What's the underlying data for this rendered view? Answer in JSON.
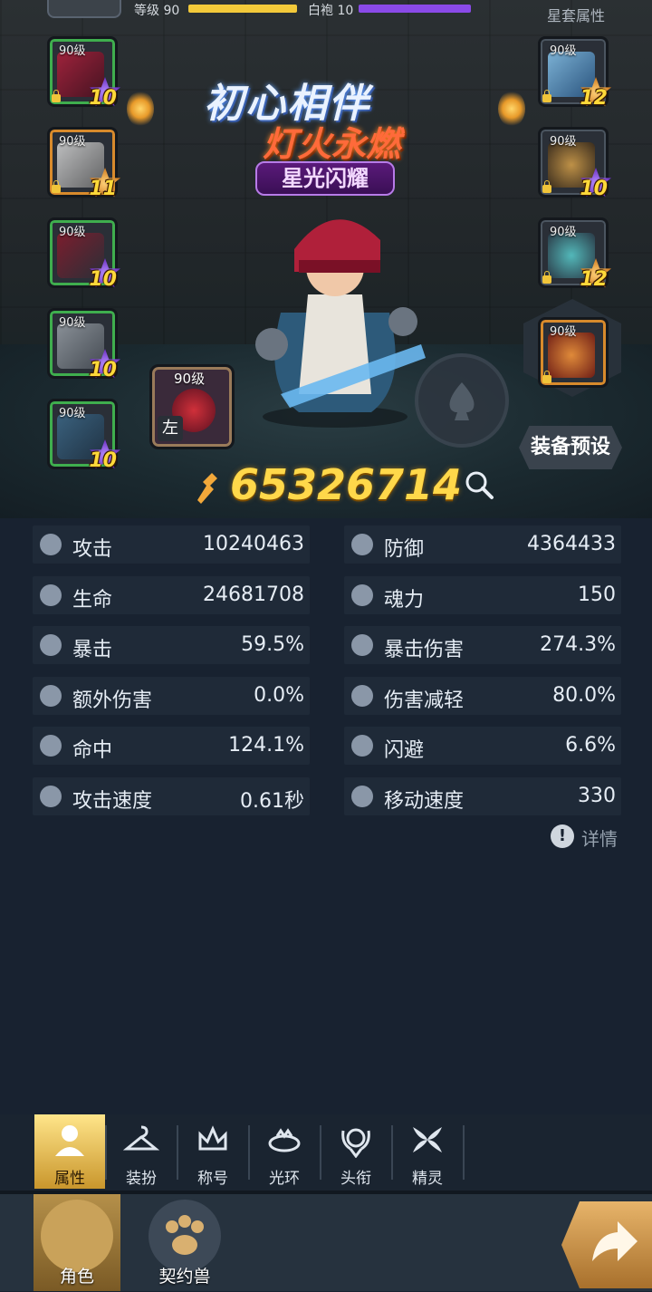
{
  "header": {
    "level_label": "等级 90",
    "level_fill": 1.0,
    "rank_label": "白袍 10",
    "rank_fill": 1.0,
    "set_attr_label": "星套属性"
  },
  "event_titles": {
    "line1": "初心相伴",
    "line2": "灯火永燃",
    "line3": "星光闪耀"
  },
  "equipment_left": [
    {
      "level": "90级",
      "stars": "10"
    },
    {
      "level": "90级",
      "stars": "11"
    },
    {
      "level": "90级",
      "stars": "10"
    },
    {
      "level": "90级",
      "stars": "10"
    },
    {
      "level": "90级",
      "stars": "10"
    }
  ],
  "equipment_right": [
    {
      "level": "90级",
      "stars": "12"
    },
    {
      "level": "90级",
      "stars": "10"
    },
    {
      "level": "90级",
      "stars": "12"
    },
    {
      "level": "90级",
      "stars": ""
    }
  ],
  "weapon_slot": {
    "level": "90级",
    "tag": "左"
  },
  "preset_button": "装备预设",
  "combat_power": "65326714",
  "stats": [
    {
      "name": "攻击",
      "value": "10240463",
      "icon": "sword-icon"
    },
    {
      "name": "防御",
      "value": "4364433",
      "icon": "shield-icon"
    },
    {
      "name": "生命",
      "value": "24681708",
      "icon": "heart-icon"
    },
    {
      "name": "魂力",
      "value": "150",
      "icon": "soul-icon"
    },
    {
      "name": "暴击",
      "value": "59.5%",
      "icon": "crit-icon"
    },
    {
      "name": "暴击伤害",
      "value": "274.3%",
      "icon": "crit-damage-icon"
    },
    {
      "name": "额外伤害",
      "value": "0.0%",
      "icon": "extra-damage-icon"
    },
    {
      "name": "伤害减轻",
      "value": "80.0%",
      "icon": "damage-reduction-icon"
    },
    {
      "name": "命中",
      "value": "124.1%",
      "icon": "target-icon"
    },
    {
      "name": "闪避",
      "value": "6.6%",
      "icon": "dodge-icon"
    },
    {
      "name": "攻击速度",
      "value": "0.61秒",
      "icon": "attack-speed-icon"
    },
    {
      "name": "移动速度",
      "value": "330",
      "icon": "move-speed-icon"
    }
  ],
  "detail_link": "详情",
  "subtabs": [
    {
      "label": "属性",
      "icon": "person-icon"
    },
    {
      "label": "装扮",
      "icon": "hanger-icon"
    },
    {
      "label": "称号",
      "icon": "crown-icon"
    },
    {
      "label": "光环",
      "icon": "halo-icon"
    },
    {
      "label": "头衔",
      "icon": "badge-icon"
    },
    {
      "label": "精灵",
      "icon": "spirit-icon"
    }
  ],
  "bottom_nav": [
    {
      "label": "角色",
      "icon": "character-icon"
    },
    {
      "label": "契约兽",
      "icon": "paw-icon"
    }
  ],
  "colors": {
    "accent_gold": "#ffd84a",
    "level_bar": "#f2c93a",
    "rank_bar": "#8a4ae8",
    "panel_bg": "#182230"
  }
}
